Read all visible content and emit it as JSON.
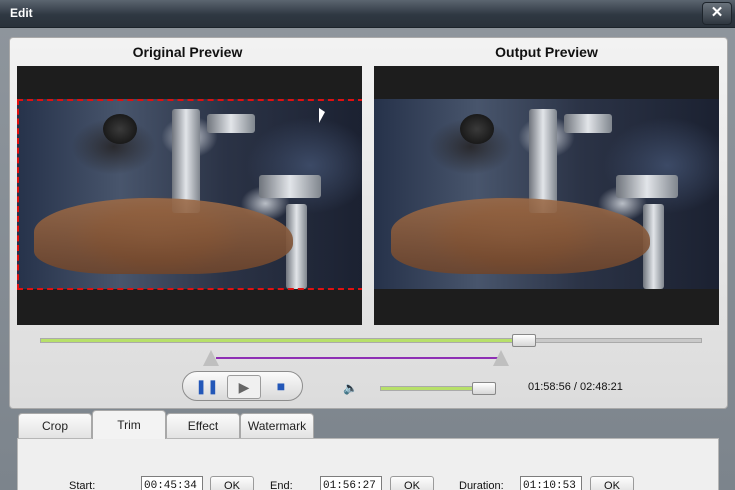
{
  "window": {
    "title": "Edit",
    "close_glyph": "✕"
  },
  "preview": {
    "original_label": "Original Preview",
    "output_label": "Output Preview",
    "seek_progress": 0.73,
    "volume_level": 0.93,
    "time_display": "01:58:56 / 02:48:21"
  },
  "controls": {
    "pause_glyph": "❚❚",
    "play_glyph": "▶",
    "stop_glyph": "■",
    "volume_glyph": "🔈"
  },
  "tabs": [
    {
      "label": "Crop"
    },
    {
      "label": "Trim"
    },
    {
      "label": "Effect"
    },
    {
      "label": "Watermark"
    }
  ],
  "trim": {
    "start_label": "Start:",
    "start_value": "00:45:34",
    "end_label": "End:",
    "end_value": "01:56:27",
    "duration_label": "Duration:",
    "duration_value": "01:10:53",
    "ok_label": "OK"
  },
  "colors": {
    "accent": "#2357b8",
    "trim_line": "#8e2fb4",
    "crop_border": "#e01010",
    "seek_fill": "#b7e06a"
  },
  "icons": [
    "close-icon",
    "pause-icon",
    "play-frame-icon",
    "stop-icon",
    "volume-icon",
    "cursor-icon"
  ]
}
